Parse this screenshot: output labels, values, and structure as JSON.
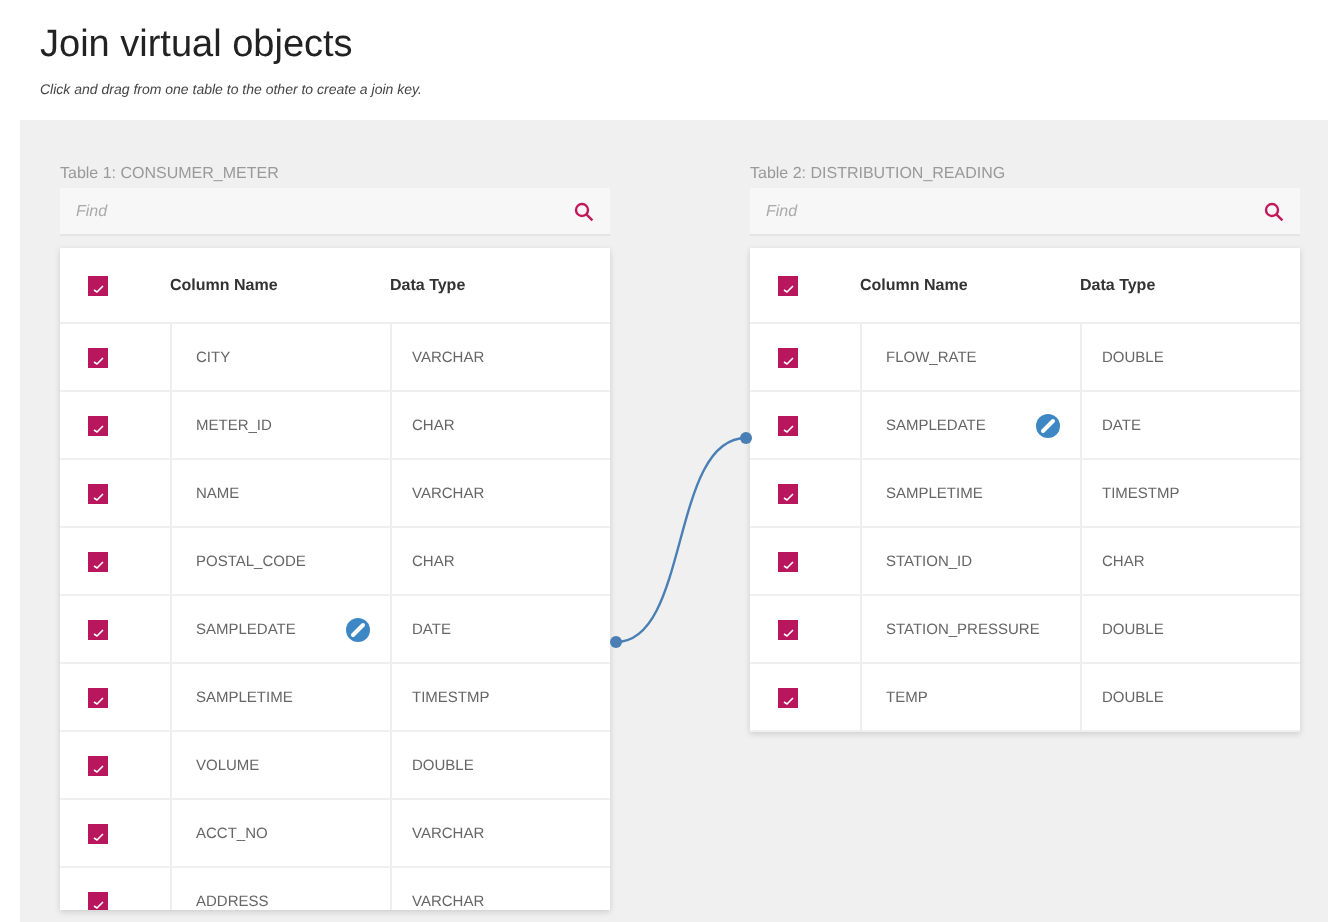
{
  "header": {
    "title": "Join virtual objects",
    "subtitle": "Click and drag from one table to the other to create a join key."
  },
  "tables": [
    {
      "label": "Table 1: CONSUMER_METER",
      "search": {
        "placeholder": "Find"
      },
      "all_checked": true,
      "columns": [
        "Column Name",
        "Data Type"
      ],
      "rows": [
        {
          "name": "CITY",
          "type": "VARCHAR",
          "checked": true,
          "joined": false
        },
        {
          "name": "METER_ID",
          "type": "CHAR",
          "checked": true,
          "joined": false
        },
        {
          "name": "NAME",
          "type": "VARCHAR",
          "checked": true,
          "joined": false
        },
        {
          "name": "POSTAL_CODE",
          "type": "CHAR",
          "checked": true,
          "joined": false
        },
        {
          "name": "SAMPLEDATE",
          "type": "DATE",
          "checked": true,
          "joined": true
        },
        {
          "name": "SAMPLETIME",
          "type": "TIMESTMP",
          "checked": true,
          "joined": false
        },
        {
          "name": "VOLUME",
          "type": "DOUBLE",
          "checked": true,
          "joined": false
        },
        {
          "name": "ACCT_NO",
          "type": "VARCHAR",
          "checked": true,
          "joined": false
        },
        {
          "name": "ADDRESS",
          "type": "VARCHAR",
          "checked": true,
          "joined": false
        }
      ]
    },
    {
      "label": "Table 2: DISTRIBUTION_READING",
      "search": {
        "placeholder": "Find"
      },
      "all_checked": true,
      "columns": [
        "Column Name",
        "Data Type"
      ],
      "rows": [
        {
          "name": "FLOW_RATE",
          "type": "DOUBLE",
          "checked": true,
          "joined": false
        },
        {
          "name": "SAMPLEDATE",
          "type": "DATE",
          "checked": true,
          "joined": true
        },
        {
          "name": "SAMPLETIME",
          "type": "TIMESTMP",
          "checked": true,
          "joined": false
        },
        {
          "name": "STATION_ID",
          "type": "CHAR",
          "checked": true,
          "joined": false
        },
        {
          "name": "STATION_PRESSURE",
          "type": "DOUBLE",
          "checked": true,
          "joined": false
        },
        {
          "name": "TEMP",
          "type": "DOUBLE",
          "checked": true,
          "joined": false
        }
      ]
    }
  ]
}
